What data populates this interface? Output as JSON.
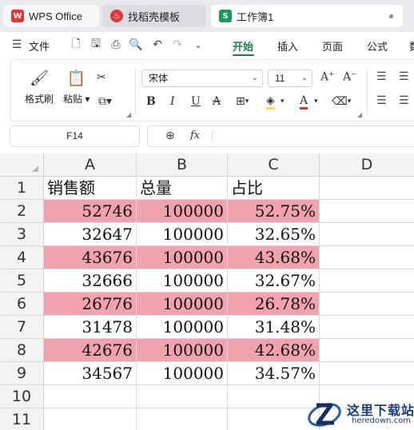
{
  "tabs": [
    {
      "label": "WPS Office",
      "icon": "wps-logo-icon",
      "badge": "W"
    },
    {
      "label": "找稻壳模板",
      "icon": "docer-flame-icon",
      "badge": "♨"
    },
    {
      "label": "工作簿1",
      "icon": "spreadsheet-s-icon",
      "badge": "S"
    }
  ],
  "menu": {
    "file_label": "文件",
    "tabs": [
      "开始",
      "插入",
      "页面",
      "公式",
      "数"
    ],
    "active_tab": "开始",
    "accent_color": "#1a7f4b"
  },
  "ribbon": {
    "format_painter_label": "格式刷",
    "paste_label": "粘贴",
    "font_name": "宋体",
    "font_size": "11",
    "bold": "B",
    "italic": "I",
    "underline": "U",
    "strikethrough": "A",
    "grow_font": "A⁺",
    "shrink_font": "A⁻"
  },
  "formula_bar": {
    "name_box": "F14",
    "fx": "fx",
    "formula": ""
  },
  "sheet": {
    "columns": [
      "A",
      "B",
      "C",
      "D"
    ],
    "row_numbers": [
      "1",
      "2",
      "3",
      "4",
      "5",
      "6",
      "7",
      "8",
      "9",
      "10",
      "11"
    ],
    "header": [
      "销售额",
      "总量",
      "占比"
    ],
    "rows": [
      {
        "sales": "52746",
        "total": "100000",
        "ratio": "52.75%",
        "highlight": true
      },
      {
        "sales": "32647",
        "total": "100000",
        "ratio": "32.65%",
        "highlight": false
      },
      {
        "sales": "43676",
        "total": "100000",
        "ratio": "43.68%",
        "highlight": true
      },
      {
        "sales": "32666",
        "total": "100000",
        "ratio": "32.67%",
        "highlight": false
      },
      {
        "sales": "26776",
        "total": "100000",
        "ratio": "26.78%",
        "highlight": true
      },
      {
        "sales": "31478",
        "total": "100000",
        "ratio": "31.48%",
        "highlight": false
      },
      {
        "sales": "42676",
        "total": "100000",
        "ratio": "42.68%",
        "highlight": true
      },
      {
        "sales": "34567",
        "total": "100000",
        "ratio": "34.57%",
        "highlight": false
      }
    ],
    "highlight_color": "#f0a2ae"
  },
  "watermark": {
    "title": "这里下载站",
    "url": "heredown.com"
  }
}
